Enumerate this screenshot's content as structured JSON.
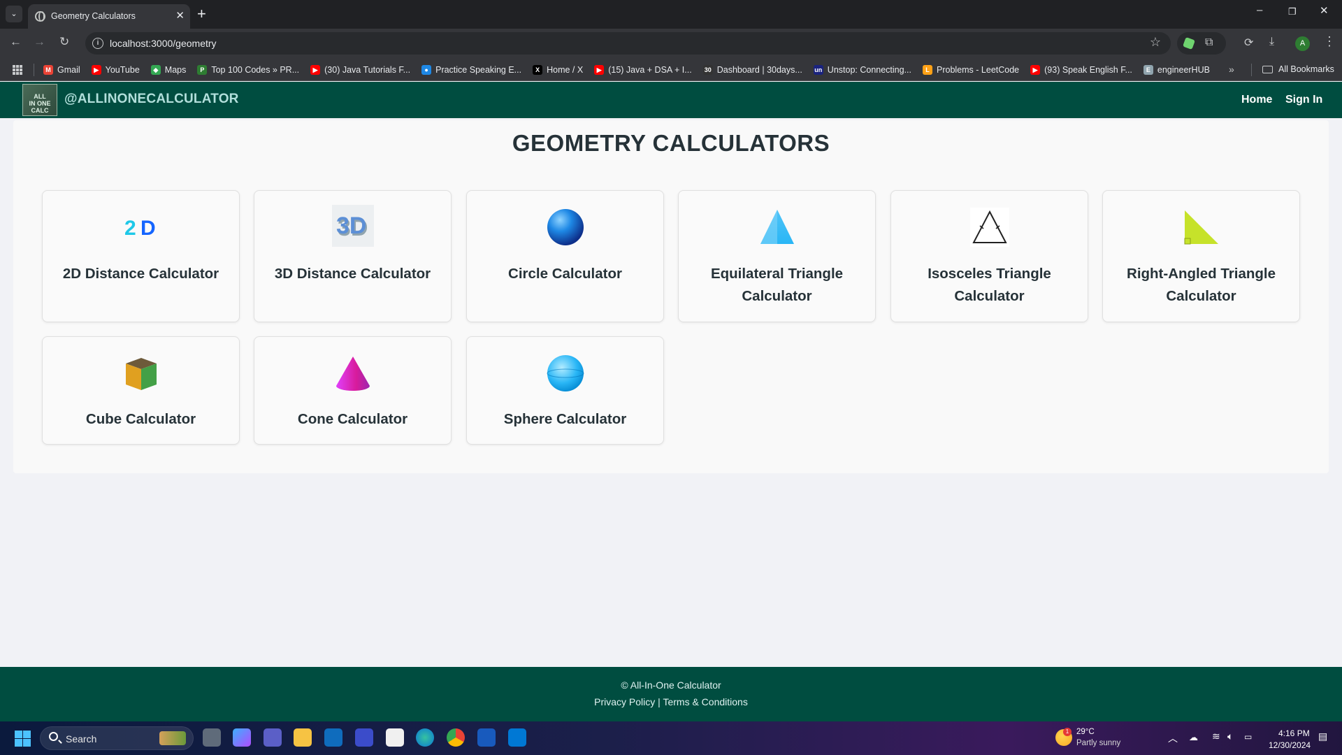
{
  "browser": {
    "tab_title": "Geometry Calculators",
    "url": "localhost:3000/geometry",
    "bookmarks": [
      {
        "label": "Gmail",
        "color": "#ea4335",
        "glyph": "M"
      },
      {
        "label": "YouTube",
        "color": "#ff0000",
        "glyph": "▶"
      },
      {
        "label": "Maps",
        "color": "#34a853",
        "glyph": "◆"
      },
      {
        "label": "Top 100 Codes » PR...",
        "color": "#2e7d32",
        "glyph": "P"
      },
      {
        "label": "(30) Java Tutorials F...",
        "color": "#ff0000",
        "glyph": "▶"
      },
      {
        "label": "Practice Speaking E...",
        "color": "#1e88e5",
        "glyph": "●"
      },
      {
        "label": "Home / X",
        "color": "#000000",
        "glyph": "X"
      },
      {
        "label": "(15) Java + DSA + I...",
        "color": "#ff0000",
        "glyph": "▶"
      },
      {
        "label": "Dashboard | 30days...",
        "color": "#333333",
        "glyph": "30"
      },
      {
        "label": "Unstop: Connecting...",
        "color": "#1a237e",
        "glyph": "un"
      },
      {
        "label": "Problems - LeetCode",
        "color": "#ffa116",
        "glyph": "L"
      },
      {
        "label": "(93) Speak English F...",
        "color": "#ff0000",
        "glyph": "▶"
      },
      {
        "label": "engineerHUB",
        "color": "#90a4ae",
        "glyph": "E"
      }
    ],
    "all_bookmarks": "All Bookmarks",
    "profile_initial": "A"
  },
  "site": {
    "brand": "@ALLINONECALCULATOR",
    "logo_text": "ALL IN ONE CALC",
    "nav": {
      "home": "Home",
      "signin": "Sign In"
    },
    "page_title": "GEOMETRY CALCULATORS",
    "calculators": [
      {
        "label": "2D Distance Calculator",
        "icon": "2d-text-icon"
      },
      {
        "label": "3D Distance Calculator",
        "icon": "3d-text-icon"
      },
      {
        "label": "Circle Calculator",
        "icon": "blue-sphere-icon"
      },
      {
        "label": "Equilateral Triangle Calculator",
        "icon": "equilateral-triangle-icon"
      },
      {
        "label": "Isosceles Triangle Calculator",
        "icon": "isosceles-triangle-icon"
      },
      {
        "label": "Right-Angled Triangle Calculator",
        "icon": "right-triangle-icon"
      },
      {
        "label": "Cube Calculator",
        "icon": "cube-icon"
      },
      {
        "label": "Cone Calculator",
        "icon": "cone-icon"
      },
      {
        "label": "Sphere Calculator",
        "icon": "sphere-icon"
      }
    ],
    "footer": {
      "copyright": "© All-In-One Calculator",
      "privacy": "Privacy Policy",
      "separator": "|",
      "terms": "Terms & Conditions"
    },
    "colors": {
      "header_bg": "#004d40",
      "brand_text": "#b2dfdb",
      "title_text": "#263238"
    }
  },
  "taskbar": {
    "search": "Search",
    "weather_temp": "29°C",
    "weather_desc": "Partly sunny",
    "weather_badge": "1",
    "time": "4:16 PM",
    "date": "12/30/2024"
  }
}
